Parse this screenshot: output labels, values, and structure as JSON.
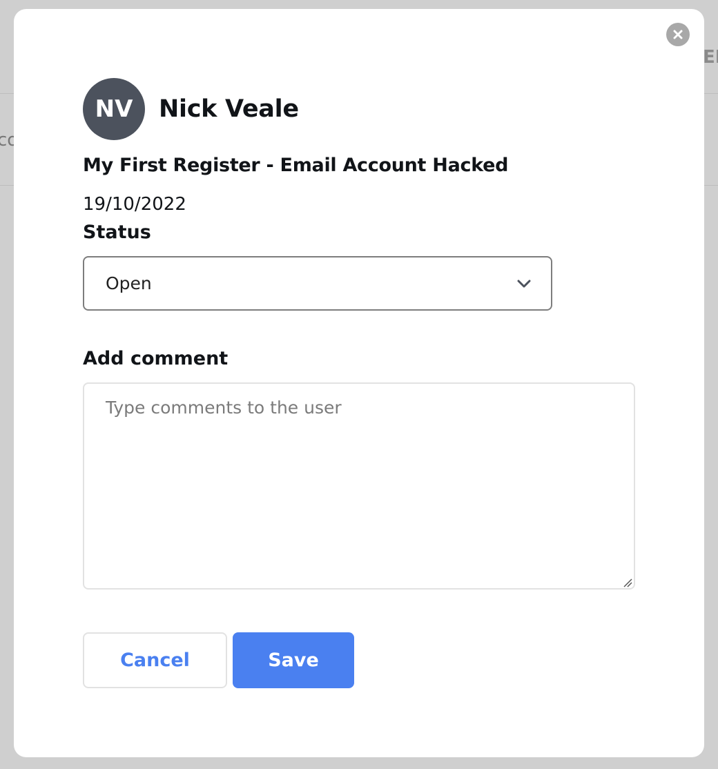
{
  "background": {
    "left_fragment": "co",
    "right_fragment": "EN"
  },
  "modal": {
    "close_icon": "close-circle-icon",
    "user": {
      "initials": "NV",
      "name": "Nick Veale"
    },
    "register_title": "My First Register - Email Account Hacked",
    "date": "19/10/2022",
    "status": {
      "label": "Status",
      "selected": "Open",
      "icon": "chevron-down-icon"
    },
    "comment": {
      "label": "Add comment",
      "placeholder": "Type comments to the user",
      "value": ""
    },
    "buttons": {
      "cancel": "Cancel",
      "save": "Save"
    }
  },
  "colors": {
    "overlay": "#cfcfcf",
    "avatar_bg": "#4c525d",
    "accent": "#4a80f0",
    "close_icon_bg": "#a8a8a8"
  }
}
